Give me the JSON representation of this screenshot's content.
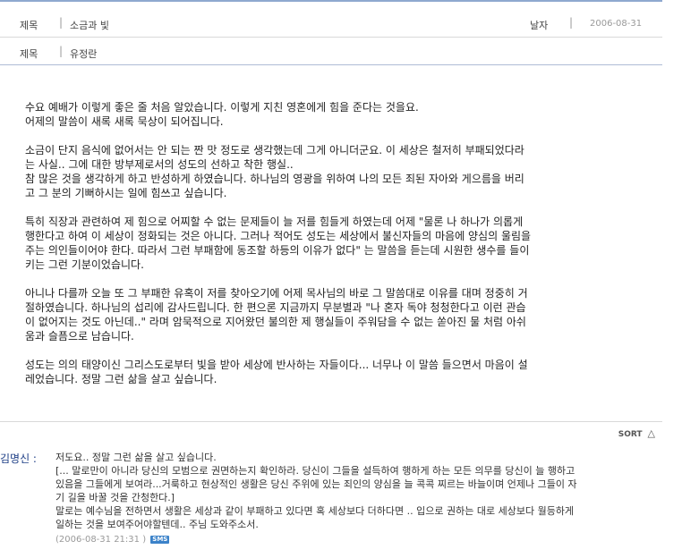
{
  "header": {
    "title_label": "제목",
    "title_value": "소금과 빛",
    "date_label": "날자",
    "date_value": "2006-08-31",
    "author_label": "제목",
    "author_value": "유정란",
    "separator": "|"
  },
  "article": {
    "paragraphs": [
      [
        "수요 예배가 이렇게 좋은 줄 처음 알았습니다. 이렇게 지친 영혼에게 힘을 준다는 것을요.",
        "어제의 말씀이 새록 새록 묵상이 되어집니다."
      ],
      [
        "소금이 단지 음식에 없어서는 안 되는 짠 맛 정도로 생각했는데 그게 아니더군요. 이 세상은 철저히 부패되었다라",
        "는 사실.. 그에 대한 방부제로서의 성도의 선하고 착한 행실..",
        "참 많은 것을 생각하게 하고 반성하게 하였습니다. 하나님의 영광을 위하여 나의 모든 죄된 자아와 게으름을 버리",
        "고 그 분의 기뻐하시는 일에 힘쓰고 싶습니다."
      ],
      [
        "특히 직장과 관련하여 제 힘으로 어찌할 수 없는 문제들이 늘 저를 힘들게 하였는데 어제 \"물론 나 하나가 의롭게",
        "행한다고 하여 이 세상이 정화되는 것은 아니다. 그러나 적어도 성도는 세상에서 불신자들의 마음에 양심의 울림을",
        "주는 의인들이어야 한다. 따라서 그런 부패함에 동조할 하등의 이유가 없다\" 는 말씀을 듣는데 시원한 생수를 들이",
        "키는 그런 기분이었습니다."
      ],
      [
        "아니나 다를까 오늘 또 그 부패한 유혹이 저를 찾아오기에 어제 목사님의 바로 그 말씀대로 이유를 대며 정중히 거",
        "절하였습니다. 하나님의 섭리에 감사드립니다. 한 편으론 지금까지 무분별과 \"나 혼자 독야 청청한다고 이런 관습",
        "이 없어지는 것도 아닌데..\" 라며 암묵적으로 지어왔던 불의한 제 행실들이 주워담을 수 없는 쏟아진 물 처럼 아쉬",
        "움과 슬픔으로 남습니다."
      ],
      [
        "성도는 의의 태양이신 그리스도로부터 빛을 받아 세상에 반사하는 자들이다... 너무나 이 말씀 들으면서 마음이 설",
        "레었습니다. 정말 그런 삶을 살고 싶습니다."
      ]
    ]
  },
  "sort": {
    "label": "SORT",
    "icon": "triangle-up-icon"
  },
  "comment": {
    "author": "김명신 :",
    "lines": [
      "저도요.. 정말 그런 삶을 살고 싶습니다.",
      "[... 말로만이 아니라 당신의 모범으로 권면하는지 확인하라. 당신이 그들을 설득하여 행하게 하는 모든 의무를 당신이 늘 행하고",
      "있음을 그들에게 보여라...거룩하고 현상적인 생활은 당신 주위에 있는 죄인의 양심을 늘 콕콕 찌르는 바늘이며 언제나 그들이 자",
      "기 길을 바꿀 것을 간청한다.]",
      "말로는 예수님을 전하면서 생활은 세상과 같이 부패하고 있다면 혹 세상보다 더하다면 .. 입으로 권하는 대로 세상보다 월등하게",
      "일하는 것을 보여주어야할텐데.. 주님 도와주소서."
    ],
    "timestamp": "(2006-08-31 21:31 )",
    "badge": "SMS"
  },
  "colors": {
    "accent_line": "#8fa9cf",
    "author": "#1e3f86",
    "badge": "#3b82c9"
  }
}
